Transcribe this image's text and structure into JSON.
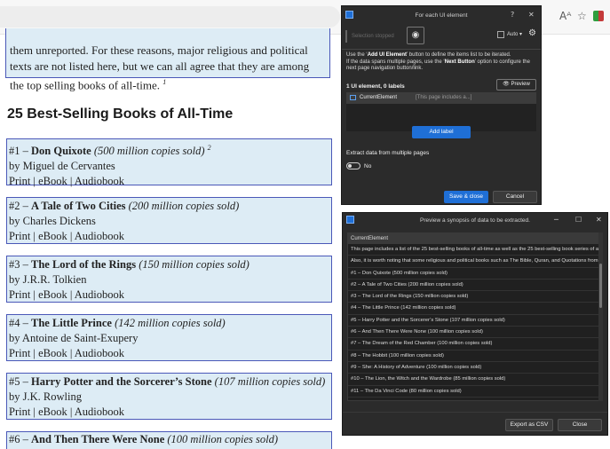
{
  "browser": {
    "reader_icon": "Aᴬ",
    "favorite_icon": "☆"
  },
  "intro": {
    "text": "them unreported. For these reasons, major religious and political texts are not listed here, but we can all agree that they are among the top selling books of all-time.",
    "footnote": "1"
  },
  "section_title": "25 Best-Selling Books of All-Time",
  "books": [
    {
      "rank": "#1 – ",
      "title": "Don Quixote",
      "copies": "(500 million copies sold)",
      "footnote": "2",
      "author": "by Miguel de Cervantes",
      "formats": "Print | eBook | Audiobook"
    },
    {
      "rank": "#2 – ",
      "title": "A Tale of Two Cities",
      "copies": "(200 million copies sold)",
      "footnote": "",
      "author": "by Charles Dickens",
      "formats": "Print | eBook | Audiobook"
    },
    {
      "rank": "#3 – ",
      "title": "The Lord of the Rings",
      "copies": "(150 million copies sold)",
      "footnote": "",
      "author": "by J.R.R. Tolkien",
      "formats": "Print | eBook | Audiobook"
    },
    {
      "rank": "#4 – ",
      "title": "The Little Prince",
      "copies": "(142 million copies sold)",
      "footnote": "",
      "author": "by Antoine de Saint-Exupery",
      "formats": "Print | eBook | Audiobook"
    },
    {
      "rank": "#5 – ",
      "title": "Harry Potter and the Sorcerer’s Stone",
      "copies": "(107 million copies sold)",
      "footnote": "",
      "author": "by J.K. Rowling",
      "formats": "Print | eBook | Audiobook"
    }
  ],
  "book_cut": {
    "rank": "#6 – ",
    "title": "And Then There Were None",
    "copies": "(100 million copies sold)"
  },
  "dialog1": {
    "title": "For each UI element",
    "help_btn": "?",
    "selection_status": "Selection stopped",
    "auto_label": "Auto",
    "help_text_1a": "Use the ‘",
    "help_text_1b": "Add UI Element",
    "help_text_1c": "’ button to define the items list to be iterated.",
    "help_text_2a": "If the data spans multiple pages, use the ‘",
    "help_text_2b": "Next Button",
    "help_text_2c": "’ option to configure the next page navigation button/link.",
    "count_label": "1 UI element, 0 labels",
    "preview_label": "Preview",
    "element_name": "CurrentElement",
    "element_value": "[This page includes a...]",
    "add_label": "Add label",
    "extract_label": "Extract data from multiple pages",
    "toggle_state": "No",
    "save_label": "Save & close",
    "cancel_label": "Cancel"
  },
  "dialog2": {
    "title": "Preview a synopsis of data to be extracted.",
    "column_header": "CurrentElement",
    "rows": [
      "This page includes a list of the 25 best-selling books of all-time as well as the 25 best-selling book series of all-time",
      "Also, it is worth noting that some religious and political books such as The Bible, Quran, and Quotations from Chairman Mao",
      "#1 – Don Quixote (500 million copies sold)",
      "#2 – A Tale of Two Cities (200 million copies sold)",
      "#3 – The Lord of the Rings (150 million copies sold)",
      "#4 – The Little Prince (142 million copies sold)",
      "#5 – Harry Potter and the Sorcerer’s Stone (107 million copies sold)",
      "#6 – And Then There Were None (100 million copies sold)",
      "#7 – The Dream of the Red Chamber (100 million copies sold)",
      "#8 – The Hobbit (100 million copies sold)",
      "#9 – She: A History of Adventure (100 million copies sold)",
      "#10 – The Lion, the Witch and the Wardrobe (85 million copies sold)",
      "#11 – The Da Vinci Code (80 million copies sold)",
      "#12 – Think and Grow Rich (70 million copies sold)"
    ],
    "export_label": "Export as CSV",
    "close_label": "Close"
  },
  "colors": {
    "card_bg": "#ddecf5",
    "card_border": "#4a58b8",
    "dialog_bg": "#2b2b2b",
    "accent": "#1f6fd6"
  }
}
